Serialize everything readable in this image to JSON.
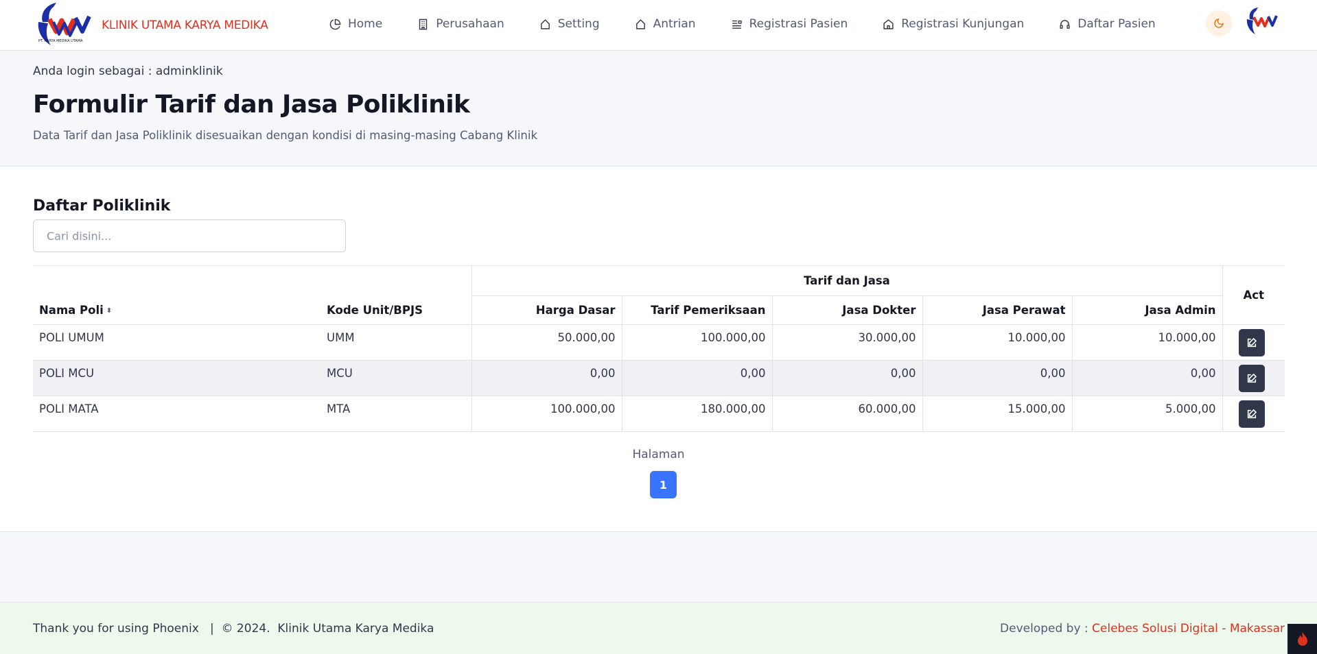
{
  "app": {
    "brand_name": "KLINIK UTAMA KARYA MEDIKA",
    "logo_caption": "PT. KARYA MEDIKA UTAMA"
  },
  "nav": {
    "items": [
      {
        "label": "Home",
        "icon": "pie-chart-icon"
      },
      {
        "label": "Perusahaan",
        "icon": "building-icon"
      },
      {
        "label": "Setting",
        "icon": "tag-icon"
      },
      {
        "label": "Antrian",
        "icon": "tag-icon"
      },
      {
        "label": "Registrasi Pasien",
        "icon": "list-icon"
      },
      {
        "label": "Registrasi Kunjungan",
        "icon": "home-icon"
      },
      {
        "label": "Daftar Pasien",
        "icon": "headset-icon"
      }
    ],
    "theme_icon": "moon-icon"
  },
  "header": {
    "login_text": "Anda login sebagai : adminklinik",
    "title": "Formulir Tarif dan Jasa Poliklinik",
    "subtitle": "Data Tarif dan Jasa Poliklinik disesuaikan dengan kondisi di masing-masing Cabang Klinik"
  },
  "main": {
    "section_title": "Daftar Poliklinik",
    "search_placeholder": "Cari disini...",
    "table": {
      "group_header": "Tarif dan Jasa",
      "columns": {
        "nama_poli": "Nama Poli",
        "kode": "Kode Unit/BPJS",
        "harga_dasar": "Harga Dasar",
        "tarif_pemeriksaan": "Tarif Pemeriksaan",
        "jasa_dokter": "Jasa Dokter",
        "jasa_perawat": "Jasa Perawat",
        "jasa_admin": "Jasa Admin",
        "act": "Act"
      },
      "rows": [
        {
          "nama": "POLI UMUM",
          "kode": "UMM",
          "harga_dasar": "50.000,00",
          "tarif_pemeriksaan": "100.000,00",
          "jasa_dokter": "30.000,00",
          "jasa_perawat": "10.000,00",
          "jasa_admin": "10.000,00"
        },
        {
          "nama": "POLI MCU",
          "kode": "MCU",
          "harga_dasar": "0,00",
          "tarif_pemeriksaan": "0,00",
          "jasa_dokter": "0,00",
          "jasa_perawat": "0,00",
          "jasa_admin": "0,00"
        },
        {
          "nama": "POLI MATA",
          "kode": "MTA",
          "harga_dasar": "100.000,00",
          "tarif_pemeriksaan": "180.000,00",
          "jasa_dokter": "60.000,00",
          "jasa_perawat": "15.000,00",
          "jasa_admin": "5.000,00"
        }
      ]
    },
    "pagination": {
      "label": "Halaman",
      "current_page": "1"
    }
  },
  "footer": {
    "left_text": "Thank you for using Phoenix   |  © 2024.  Klinik Utama Karya Medika",
    "developed_by_label": "Developed by : ",
    "developer": "Celebes Solusi Digital - Makassar"
  },
  "colors": {
    "brand_red": "#e0301e",
    "primary_blue": "#3874ff",
    "dark_button": "#31374a",
    "footer_bg": "#edf9ec",
    "band_bg": "#f5f7fa"
  }
}
